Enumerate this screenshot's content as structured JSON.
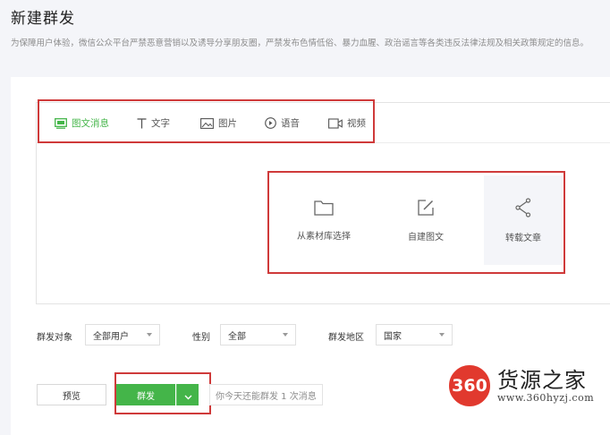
{
  "page": {
    "title": "新建群发",
    "notice": "为保障用户体验，微信公众平台严禁恶意营销以及诱导分享朋友圈，严禁发布色情低俗、暴力血腥、政治谣言等各类违反法律法规及相关政策规定的信息。"
  },
  "tabs": [
    {
      "label": "图文消息",
      "icon": "news-icon",
      "active": true
    },
    {
      "label": "文字",
      "icon": "text-icon"
    },
    {
      "label": "图片",
      "icon": "image-icon"
    },
    {
      "label": "语音",
      "icon": "voice-icon"
    },
    {
      "label": "视频",
      "icon": "video-icon"
    }
  ],
  "options": [
    {
      "label": "从素材库选择",
      "icon": "folder-icon"
    },
    {
      "label": "自建图文",
      "icon": "edit-icon"
    },
    {
      "label": "转载文章",
      "icon": "share-icon"
    }
  ],
  "filters": {
    "target": {
      "label": "群发对象",
      "value": "全部用户"
    },
    "gender": {
      "label": "性别",
      "value": "全部"
    },
    "region": {
      "label": "群发地区",
      "value": "国家"
    }
  },
  "actions": {
    "preview": "预览",
    "send": "群发",
    "quota": "你今天还能群发 1 次消息"
  },
  "watermark": {
    "badge": "360",
    "name": "货源之家",
    "url": "www.360hyzj.com"
  },
  "colors": {
    "accent": "#44b549",
    "annotation": "#cf3a3a",
    "watermark": "#e1392e"
  }
}
